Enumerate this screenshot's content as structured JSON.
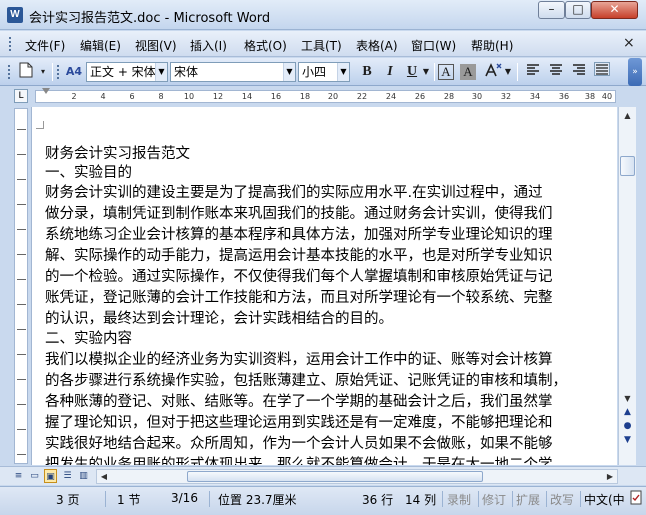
{
  "window": {
    "title": "会计实习报告范文.doc - Microsoft Word",
    "app_icon_text": "W",
    "minimize_glyph": "–",
    "maximize_glyph": "□",
    "close_glyph": "✕"
  },
  "menu": {
    "items": [
      "文件(F)",
      "编辑(E)",
      "视图(V)",
      "插入(I)",
      "格式(O)",
      "工具(T)",
      "表格(A)",
      "窗口(W)",
      "帮助(H)"
    ],
    "close_doc_glyph": "×"
  },
  "toolbar": {
    "style_value": "正文 + 宋体",
    "style_icon": "A4",
    "font_value": "宋体",
    "size_value": "小四",
    "bold": "B",
    "italic": "I",
    "underline": "U",
    "char_border": "A",
    "char_shading": "A",
    "more_glyph": "»"
  },
  "ruler": {
    "corner": "L",
    "labels": [
      "2",
      "4",
      "6",
      "8",
      "10",
      "12",
      "14",
      "16",
      "18",
      "20",
      "22",
      "24",
      "26",
      "28",
      "30",
      "32",
      "34",
      "36",
      "38",
      "40"
    ]
  },
  "document": {
    "lines": [
      "财务会计实习报告范文",
      "一、实验目的",
      "财务会计实训的建设主要是为了提高我们的实际应用水平.在实训过程中，通过",
      "做分录，填制凭证到制作账本来巩固我们的技能。通过财务会计实训，使得我们",
      "系统地练习企业会计核算的基本程序和具体方法，加强对所学专业理论知识的理",
      "解、实际操作的动手能力，提高运用会计基本技能的水平，也是对所学专业知识",
      "的一个检验。通过实际操作，不仅使得我们每个人掌握填制和审核原始凭证与记",
      "账凭证，登记账薄的会计工作技能和方法，而且对所学理论有一个较系统、完整",
      "的认识，最终达到会计理论，会计实践相结合的目的。",
      "二、实验内容",
      "我们以模拟企业的经济业务为实训资料，运用会计工作中的证、账等对会计核算",
      "的各步骤进行系统操作实验，包括账薄建立、原始凭证、记账凭证的审核和填制，",
      "各种账薄的登记、对账、结账等。在学了一个学期的基础会计之后，我们虽然掌",
      "握了理论知识，但对于把这些理论运用到实践还是有一定难度，不能够把理论和",
      "实践很好地结合起来。众所周知，作为一个会计人员如果不会做账，如果不能够",
      "把发生的业务用账的形式体现出来，那么就不能算做会计。于是在大一地二个学"
    ]
  },
  "status": {
    "page": "3 页",
    "section": "1 节",
    "page_of": "3/16",
    "position": "位置 23.7厘米",
    "line": "36 行",
    "column": "14 列",
    "rec": "录制",
    "trk": "修订",
    "ext": "扩展",
    "ovr": "改写",
    "lang": "中文(中"
  }
}
